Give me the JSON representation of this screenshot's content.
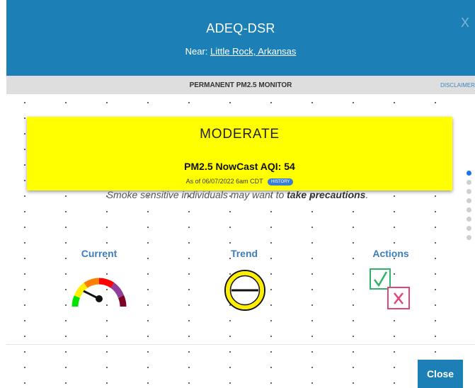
{
  "header": {
    "title": "ADEQ-DSR",
    "near_label": "Near:",
    "near_location": "Little Rock, Arkansas",
    "close_x": "X"
  },
  "monitor_bar": {
    "label": "PERMANENT PM2.5 MONITOR",
    "disclaimer": "DISCLAIMER"
  },
  "aqi": {
    "category": "MODERATE",
    "reading_label": "PM2.5 NowCast AQI:",
    "reading_value": "54",
    "as_of": "As of 06/07/2022 6am CDT",
    "history_label": "HISTORY",
    "category_color": "#ffff00"
  },
  "advisory": {
    "text": "Smoke sensitive individuals may want to",
    "emphasis": "take precautions",
    "end": "."
  },
  "columns": {
    "current": "Current",
    "trend": "Trend",
    "actions": "Actions"
  },
  "pagination": {
    "count": 8,
    "active": 1
  },
  "icons": {
    "current": "aqi-gauge-icon",
    "trend": "steady-trend-icon",
    "actions": "checkbox-actions-icon"
  },
  "footer": {
    "close_label": "Close"
  }
}
